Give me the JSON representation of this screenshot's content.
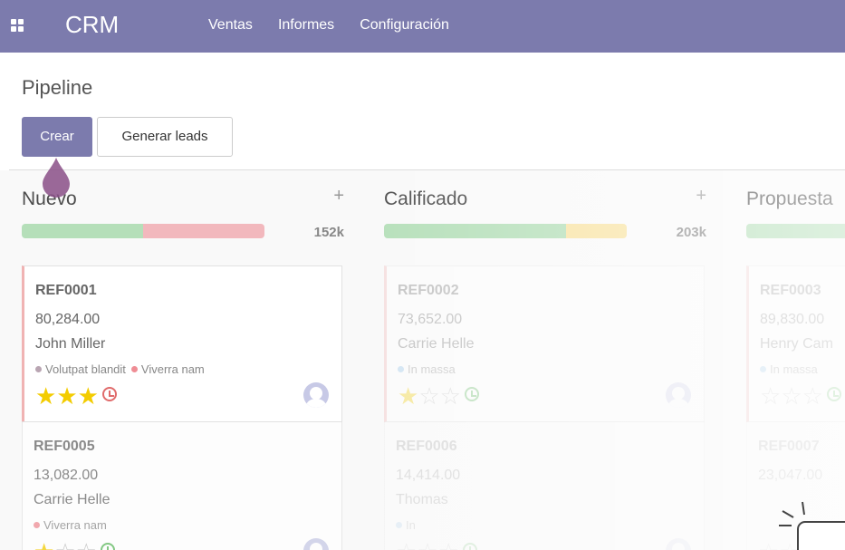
{
  "app": {
    "brand": "CRM",
    "nav": [
      "Ventas",
      "Informes",
      "Configuración"
    ]
  },
  "control_panel": {
    "breadcrumb": "Pipeline",
    "create_label": "Crear",
    "generate_label": "Generar leads"
  },
  "colors": {
    "primary": "#7c7bad",
    "green": "#b5dfb9",
    "red": "#f2b8bd",
    "yellow": "#f8e3a3",
    "star": "#f3cc00"
  },
  "columns": [
    {
      "title": "Nuevo",
      "add_icon": "+",
      "total": "152k",
      "progress": [
        {
          "color": "#b5dfb9",
          "pct": 50
        },
        {
          "color": "#f2b8bd",
          "pct": 50
        }
      ],
      "cards": [
        {
          "ref": "REF0001",
          "amount": "80,284.00",
          "partner": "John Miller",
          "tags": [
            {
              "name": "Volutpat blandit",
              "color": "#b9a5b2"
            },
            {
              "name": "Viverra nam",
              "color": "#ef8d95"
            }
          ],
          "stars": 3,
          "clock_color": "#e06b6b"
        },
        {
          "ref": "REF0005",
          "amount": "13,082.00",
          "partner": "Carrie Helle",
          "tags": [
            {
              "name": "Viverra nam",
              "color": "#ef8d95"
            }
          ],
          "stars": 1,
          "clock_color": "#5cb85c"
        }
      ]
    },
    {
      "title": "Calificado",
      "add_icon": "+",
      "total": "203k",
      "progress": [
        {
          "color": "#b5dfb9",
          "pct": 75
        },
        {
          "color": "#f8e3a3",
          "pct": 25
        }
      ],
      "cards": [
        {
          "ref": "REF0002",
          "amount": "73,652.00",
          "partner": "Carrie Helle",
          "tags": [
            {
              "name": "In massa",
              "color": "#8fc1e8"
            }
          ],
          "stars": 1,
          "clock_color": "#5cb85c"
        },
        {
          "ref": "REF0006",
          "amount": "14,414.00",
          "partner": "Thomas",
          "tags": [
            {
              "name": "In",
              "color": "#8fc1e8"
            }
          ],
          "stars": 0,
          "clock_color": "#5cb85c"
        }
      ]
    },
    {
      "title": "Propuesta",
      "add_icon": "+",
      "total": "",
      "progress": [
        {
          "color": "#b5dfb9",
          "pct": 100
        }
      ],
      "cards": [
        {
          "ref": "REF0003",
          "amount": "89,830.00",
          "partner": "Henry Cam",
          "tags": [
            {
              "name": "In massa",
              "color": "#8fc1e8"
            }
          ],
          "stars": 0,
          "clock_color": "#5cb85c"
        },
        {
          "ref": "REF0007",
          "amount": "23,047.00",
          "partner": "",
          "tags": [],
          "stars": 0,
          "clock_color": "#5cb85c"
        }
      ]
    }
  ]
}
